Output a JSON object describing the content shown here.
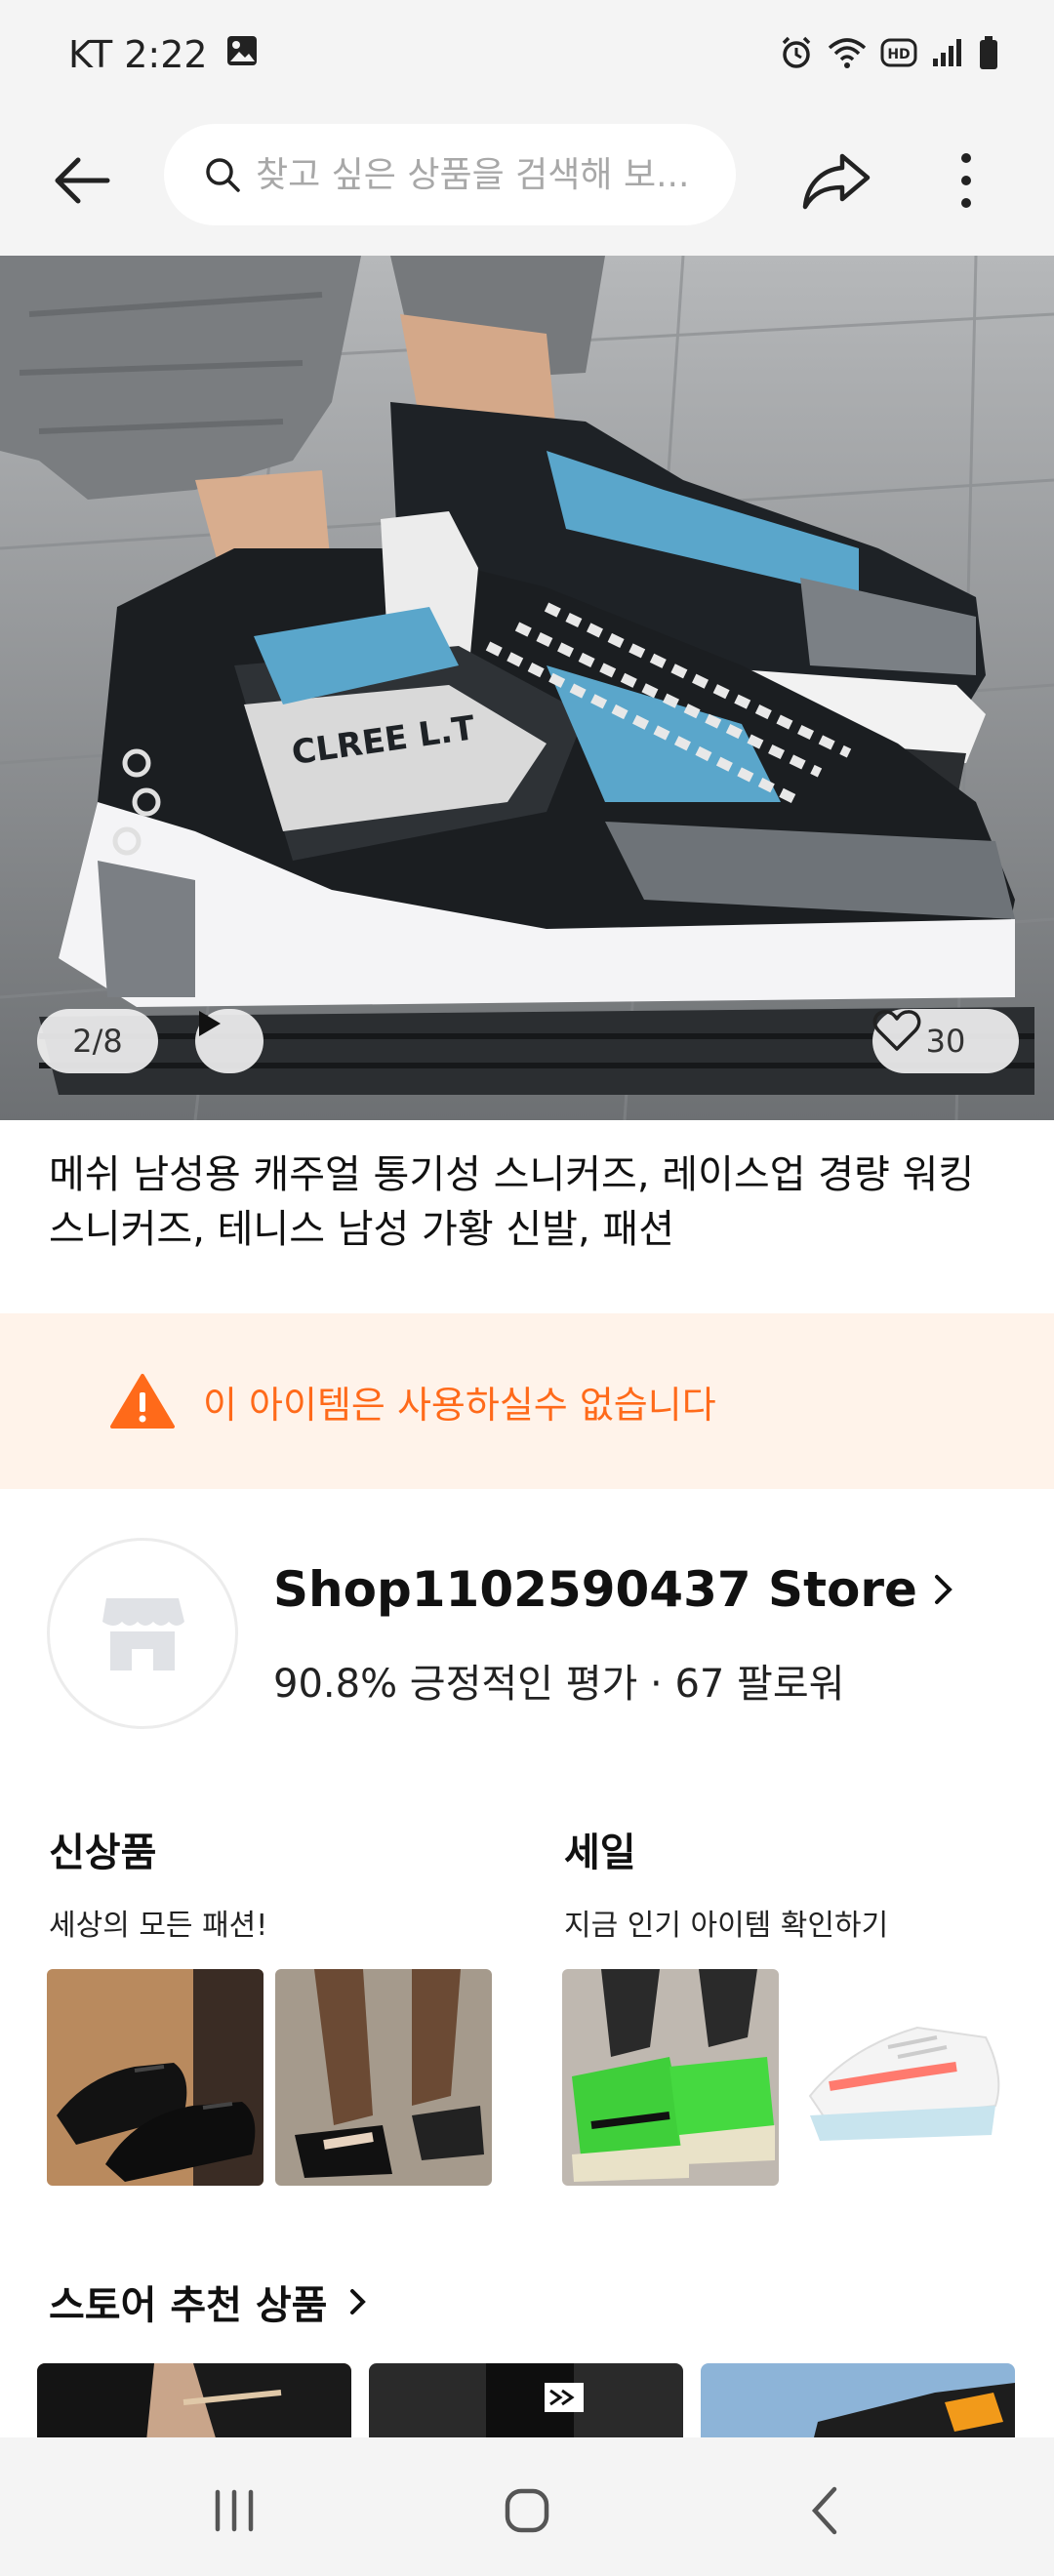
{
  "status_bar": {
    "carrier_time": "KT 2:22",
    "icons": [
      "gallery-icon",
      "alarm-icon",
      "wifi-icon",
      "hd-icon",
      "signal-icon",
      "battery-icon"
    ]
  },
  "top_nav": {
    "search_placeholder": "찾고 싶은 상품을 검색해 보...",
    "icons": [
      "back-arrow-icon",
      "search-icon",
      "share-icon",
      "more-vertical-icon"
    ]
  },
  "gallery": {
    "counter": "2/8",
    "like_count": "30"
  },
  "product": {
    "title": "메쉬 남성용 캐주얼 통기성 스니커즈, 레이스업 경량 워킹 스니커즈, 테니스 남성 가황 신발, 패션"
  },
  "warning": {
    "text": "이 아이템은 사용하실수 없습니다",
    "color": "#ff6a1a"
  },
  "store": {
    "name": "Shop1102590437 Store",
    "stats": "90.8% 긍정적인 평가 · 67 팔로워"
  },
  "promos": [
    {
      "title": "신상품",
      "subtitle": "세상의 모든 패션!"
    },
    {
      "title": "세일",
      "subtitle": "지금 인기 아이템 확인하기"
    }
  ],
  "recommend": {
    "title": "스토어 추천 상품"
  },
  "colors": {
    "accent": "#ff6a1a",
    "warning_bg": "#fff3ea",
    "bar_bg": "#f4f4f4"
  }
}
